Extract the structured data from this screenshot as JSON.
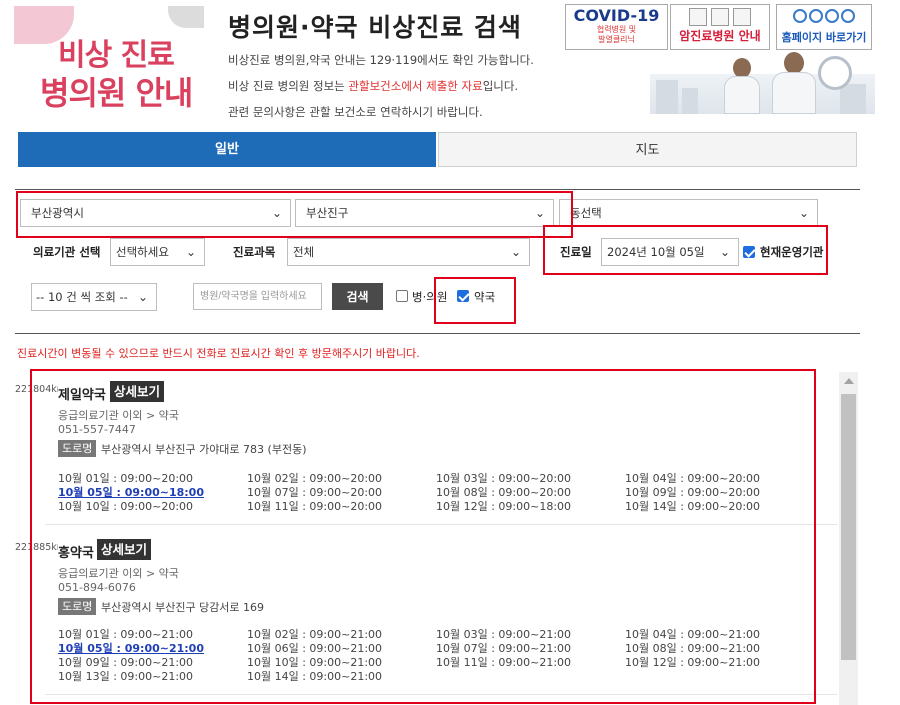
{
  "header": {
    "logo_line1": "비상 진료",
    "logo_line2": "병의원 안내",
    "title": "병의원·약국 비상진료 검색",
    "desc1": "비상진료 병의원,약국 안내는 129·119에서도 확인 가능합니다.",
    "desc2_pre": "비상 진료 병의원 정보는 ",
    "desc2_red": "관할보건소에서 제출한 자료",
    "desc2_post": "입니다.",
    "desc3": "관련 문의사항은 관할 보건소로 연락하시기 바랍니다.",
    "banner_covid": "COVID-19",
    "banner_covid_sub1": "협력병원 및",
    "banner_covid_sub2": "발열클리닉",
    "banner_cancer": "암진료병원 안내",
    "banner_home": "홈페이지 바로가기"
  },
  "tabs": {
    "general": "일반",
    "map": "지도"
  },
  "filters": {
    "city": "부산광역시",
    "district": "부산진구",
    "dong": "동선택",
    "facility_label": "의료기관 선택",
    "facility_value": "선택하세요",
    "department_label": "진료과목",
    "department_value": "전체",
    "date_label": "진료일",
    "date_value": "2024년 10월 05일",
    "open_now_label": "현재운영기관",
    "page_size": "-- 10 건 씩 조회 --",
    "search_placeholder": "병원/약국명을 입력하세요",
    "search_button": "검색",
    "hospital_label": "병·의원",
    "pharmacy_label": "약국"
  },
  "notice": "진료시간이 변동될 수 있으므로 반드시 전화로 진료시간 확인 후 방문해주시기 바랍니다.",
  "results": [
    {
      "distance": "221804km",
      "name": "제일약국",
      "detail": "상세보기",
      "category": "응급의료기관 이외 > 약국",
      "phone": "051-557-7447",
      "road": "도로명",
      "address": "부산광역시 부산진구 가야대로 783 (부전동)",
      "hours": [
        [
          "10월 01일 : 09:00~20:00",
          "10월 02일 : 09:00~20:00",
          "10월 03일 : 09:00~20:00",
          "10월 04일 : 09:00~20:00"
        ],
        [
          "10월 05일 : 09:00~18:00",
          "10월 07일 : 09:00~20:00",
          "10월 08일 : 09:00~20:00",
          "10월 09일 : 09:00~20:00"
        ],
        [
          "10월 10일 : 09:00~20:00",
          "10월 11일 : 09:00~20:00",
          "10월 12일 : 09:00~18:00",
          "10월 14일 : 09:00~20:00"
        ]
      ]
    },
    {
      "distance": "221885km",
      "name": "홍약국",
      "detail": "상세보기",
      "category": "응급의료기관 이외 > 약국",
      "phone": "051-894-6076",
      "road": "도로명",
      "address": "부산광역시 부산진구 당감서로 169",
      "hours": [
        [
          "10월 01일 : 09:00~21:00",
          "10월 02일 : 09:00~21:00",
          "10월 03일 : 09:00~21:00",
          "10월 04일 : 09:00~21:00"
        ],
        [
          "10월 05일 : 09:00~21:00",
          "10월 06일 : 09:00~21:00",
          "10월 07일 : 09:00~21:00",
          "10월 08일 : 09:00~21:00"
        ],
        [
          "10월 09일 : 09:00~21:00",
          "10월 10일 : 09:00~21:00",
          "10월 11일 : 09:00~21:00",
          "10월 12일 : 09:00~21:00"
        ],
        [
          "10월 13일 : 09:00~21:00",
          "10월 14일 : 09:00~21:00"
        ]
      ]
    }
  ],
  "colors": {
    "tab_active": "#1e6bb8",
    "highlight": "#e0001a",
    "notice": "#e02020",
    "today_link": "#1f3fb5"
  }
}
